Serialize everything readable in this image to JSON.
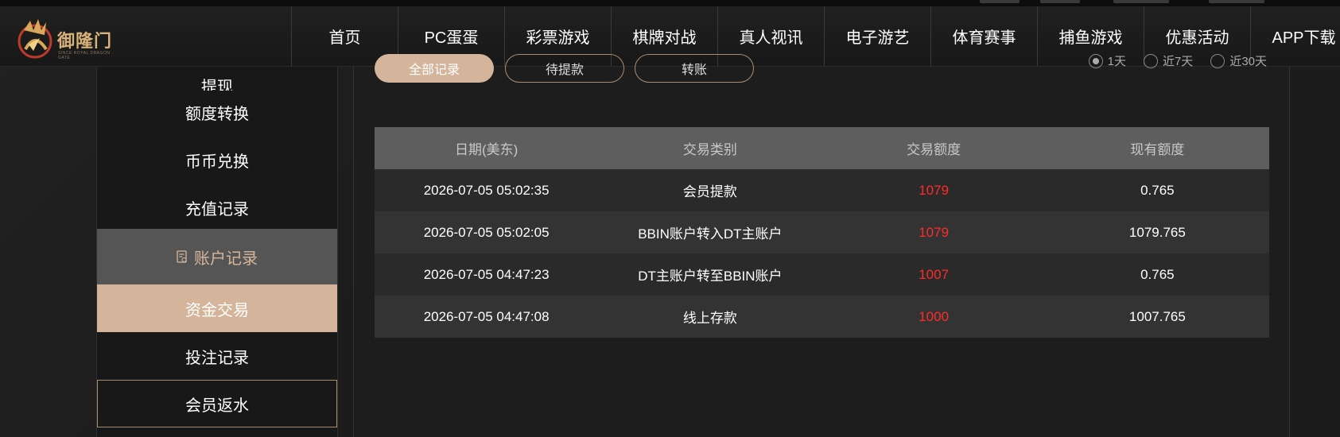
{
  "header": {
    "logo_text": "御隆门",
    "logo_sub": "SINCE ROYAL DRAGON GATE",
    "nav": [
      "首页",
      "PC蛋蛋",
      "彩票游戏",
      "棋牌对战",
      "真人视讯",
      "电子游艺",
      "体育赛事",
      "捕鱼游戏",
      "优惠活动",
      "APP下载"
    ]
  },
  "sidebar": {
    "top_clipped": "提现",
    "items": [
      "额度转换",
      "币币兑换",
      "充值记录"
    ],
    "group_label": "账户记录",
    "active": "资金交易",
    "after": [
      "投注记录",
      "会员返水"
    ]
  },
  "filters": {
    "buttons": [
      "全部记录",
      "待提款",
      "转账"
    ],
    "radios": [
      "1天",
      "近7天",
      "近30天"
    ]
  },
  "table": {
    "headers": [
      "日期(美东)",
      "交易类别",
      "交易额度",
      "现有额度"
    ],
    "rows": [
      {
        "date": "2026-07-05 05:02:35",
        "type": "会员提款",
        "amount": "1079",
        "balance": "0.765"
      },
      {
        "date": "2026-07-05 05:02:05",
        "type": "BBIN账户转入DT主账户",
        "amount": "1079",
        "balance": "1079.765"
      },
      {
        "date": "2026-07-05 04:47:23",
        "type": "DT主账户转至BBIN账户",
        "amount": "1007",
        "balance": "0.765"
      },
      {
        "date": "2026-07-05 04:47:08",
        "type": "线上存款",
        "amount": "1000",
        "balance": "1007.765"
      }
    ]
  },
  "colors": {
    "accent": "#d4b49a",
    "amount": "#ff2b2b",
    "header_bg": "#5e5e5e"
  }
}
